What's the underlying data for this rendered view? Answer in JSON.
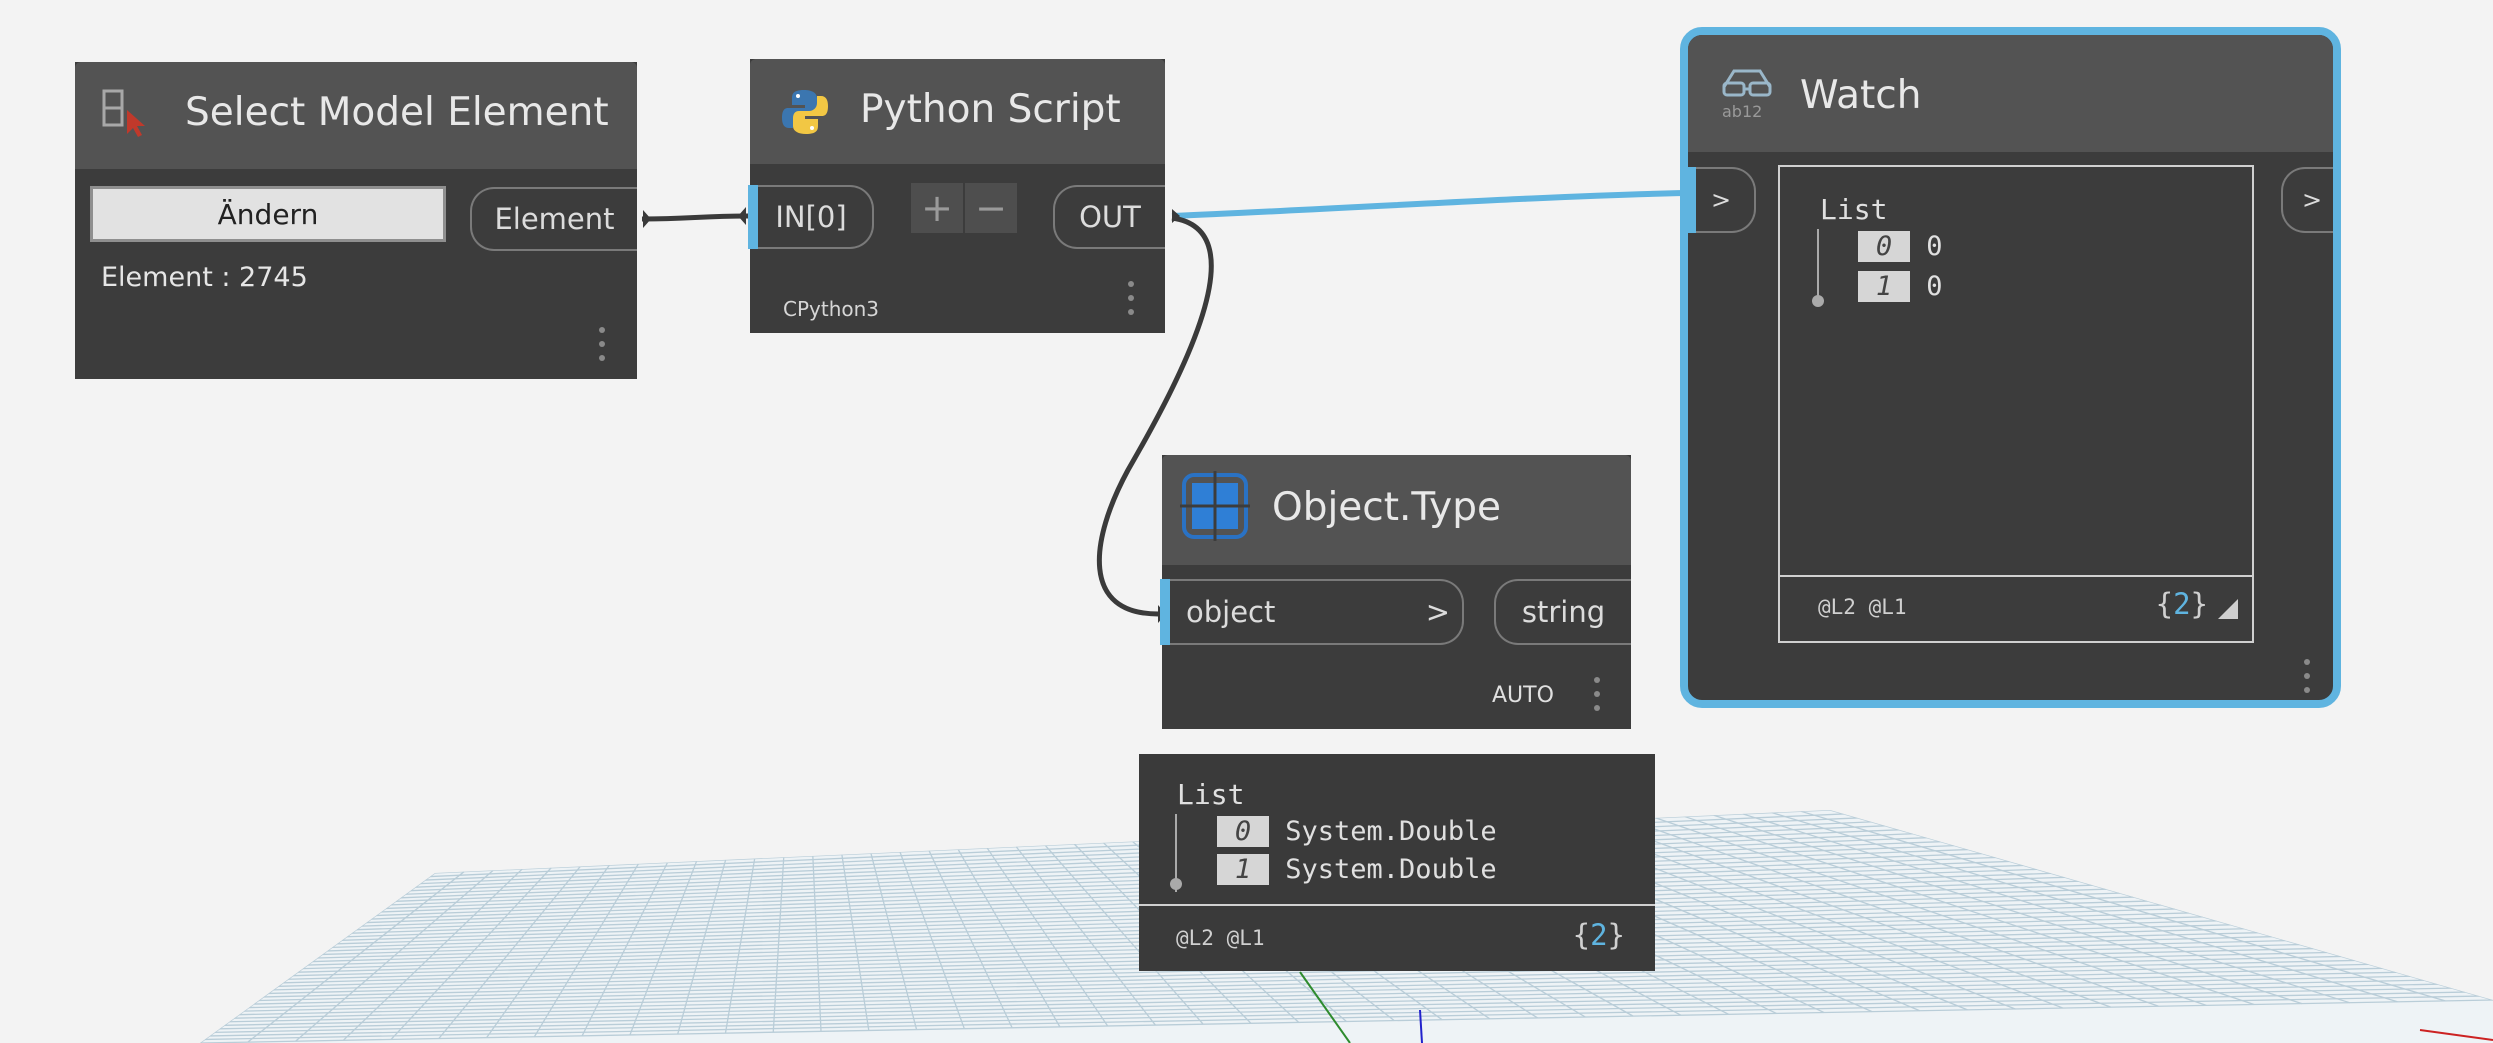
{
  "select_node": {
    "title": "Select Model Element",
    "button_label": "Ändern",
    "output_port": "Element",
    "element_info": "Element : 2745"
  },
  "python_node": {
    "title": "Python Script",
    "input_port": "IN[0]",
    "add_label": "+",
    "remove_label": "−",
    "output_port": "OUT",
    "engine": "CPython3"
  },
  "watch_node": {
    "title": "Watch",
    "input_port": ">",
    "output_port": ">",
    "list_label": "List",
    "items": [
      {
        "index": "0",
        "value": "0"
      },
      {
        "index": "1",
        "value": "0"
      }
    ],
    "levels": "@L2 @L1",
    "count_open": "{",
    "count": "2",
    "count_close": "}"
  },
  "type_node": {
    "title": "Object.Type",
    "input_port": "object",
    "input_arrow": ">",
    "output_port": "string",
    "lacing": "AUTO"
  },
  "type_preview": {
    "list_label": "List",
    "items": [
      {
        "index": "0",
        "value": "System.Double"
      },
      {
        "index": "1",
        "value": "System.Double"
      }
    ],
    "levels": "@L2 @L1",
    "count_open": "{",
    "count": "2",
    "count_close": "}"
  },
  "colors": {
    "node_body": "#3c3c3c",
    "node_header": "#535353",
    "port_accent": "#5fb4e0",
    "selection": "#5fb4e0",
    "canvas": "#f3f3f3"
  }
}
